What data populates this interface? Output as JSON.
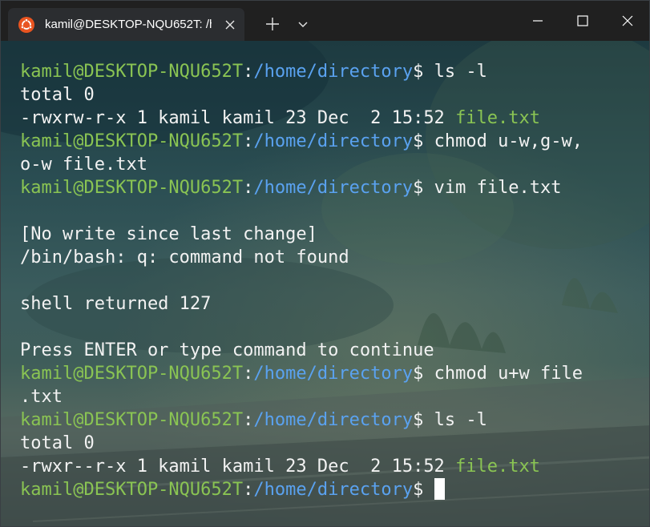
{
  "window": {
    "tab_title": "kamil@DESKTOP-NQU652T: /h"
  },
  "colors": {
    "prompt_user": "#8ac453",
    "prompt_path": "#5aa2f0",
    "text": "#f2f2f2",
    "file_highlight": "#8ac453",
    "titlebar": "#202020",
    "ubuntu_orange": "#e95420"
  },
  "icons": {
    "tab_icon": "ubuntu-logo-icon",
    "tab_close": "close-icon",
    "new_tab": "plus-icon",
    "dropdown": "chevron-down-icon",
    "minimize": "minimize-icon",
    "maximize": "maximize-icon",
    "close": "close-icon"
  },
  "terminal": {
    "prompt_user_host": "kamil@DESKTOP-NQU652T",
    "prompt_colon": ":",
    "prompt_path": "/home/directory",
    "prompt_symbol": "$ ",
    "lines": [
      {
        "type": "command",
        "text": "ls -l"
      },
      {
        "type": "output",
        "text": "total 0"
      },
      {
        "type": "listing",
        "text": "-rwxrw-r-x 1 kamil kamil 23 Dec  2 15:52 ",
        "file": "file.txt"
      },
      {
        "type": "command",
        "text": "chmod u-w,g-w,"
      },
      {
        "type": "output",
        "text": "o-w file.txt"
      },
      {
        "type": "command",
        "text": "vim file.txt"
      },
      {
        "type": "output",
        "text": ""
      },
      {
        "type": "output",
        "text": "[No write since last change]"
      },
      {
        "type": "output",
        "text": "/bin/bash: q: command not found"
      },
      {
        "type": "output",
        "text": ""
      },
      {
        "type": "output",
        "text": "shell returned 127"
      },
      {
        "type": "output",
        "text": ""
      },
      {
        "type": "output",
        "text": "Press ENTER or type command to continue"
      },
      {
        "type": "command",
        "text": "chmod u+w file"
      },
      {
        "type": "output",
        "text": ".txt"
      },
      {
        "type": "command",
        "text": "ls -l"
      },
      {
        "type": "output",
        "text": "total 0"
      },
      {
        "type": "listing",
        "text": "-rwxr--r-x 1 kamil kamil 23 Dec  2 15:52 ",
        "file": "file.txt"
      },
      {
        "type": "cursor",
        "text": ""
      }
    ]
  }
}
